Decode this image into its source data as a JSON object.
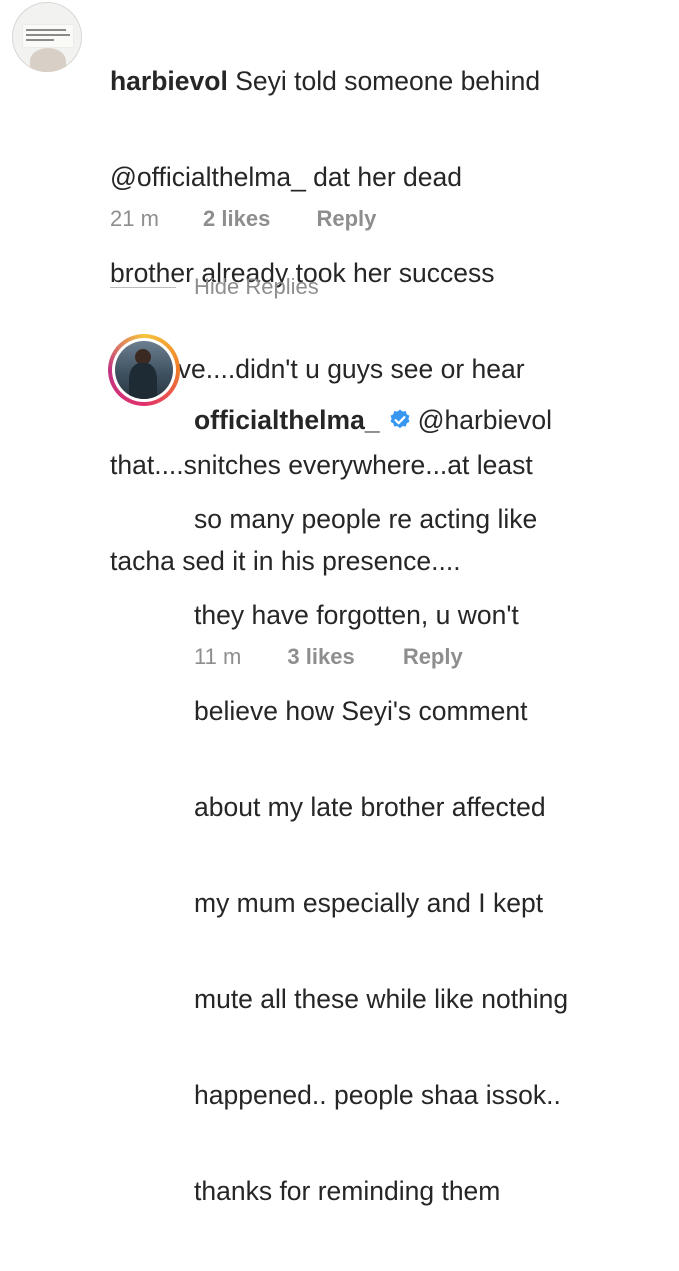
{
  "comment": {
    "username": "harbievol",
    "lines": [
      " Seyi told someone behind",
      "@officialthelma_  dat her dead",
      "brother already took her success",
      "to grave....didn't u guys see or hear",
      "that....snitches everywhere...at least",
      "tacha sed it in his presence...."
    ],
    "time": "21 m",
    "likes": "2 likes",
    "reply_label": "Reply"
  },
  "hide_replies_label": "Hide Replies",
  "reply": {
    "username": "officialthelma_",
    "mention": "@harbievol",
    "lines": [
      "so many people re acting like",
      "they have forgotten, u won't",
      "believe how Seyi's comment",
      "about my late brother affected",
      "my mum especially and I kept",
      "mute all these while like nothing",
      "happened.. people shaa issok..",
      "thanks for reminding them"
    ],
    "time": "11 m",
    "likes": "3 likes",
    "reply_label": "Reply"
  },
  "colors": {
    "text": "#262626",
    "meta": "#8e8e8e",
    "verified_badge": "#3897f0"
  },
  "icons": {
    "verified": "verified-badge-icon"
  }
}
